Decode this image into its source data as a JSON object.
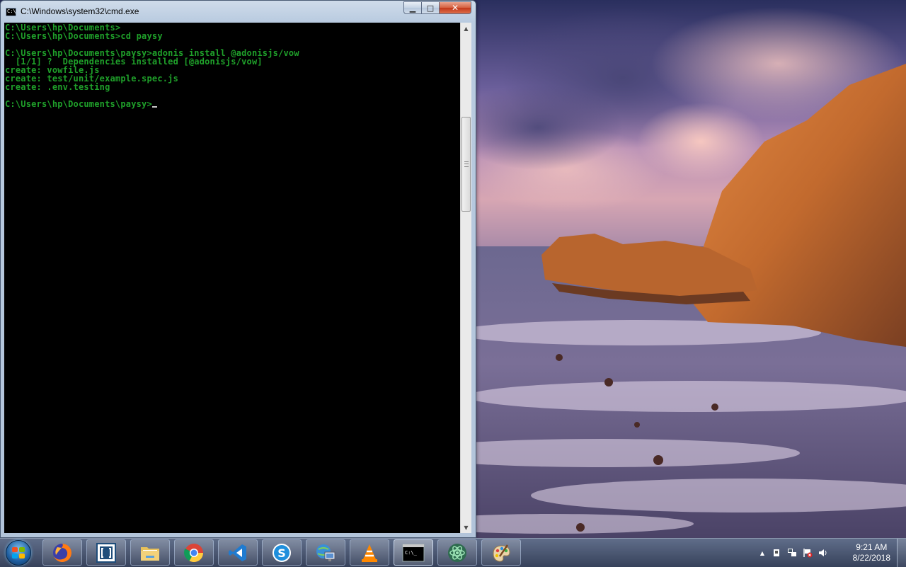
{
  "window": {
    "title": "C:\\Windows\\system32\\cmd.exe",
    "icon_label": "C:\\",
    "controls": {
      "minimize": "▁",
      "maximize": "□",
      "close": "✕"
    }
  },
  "console": {
    "lines": [
      "C:\\Users\\hp\\Documents>",
      "C:\\Users\\hp\\Documents>cd paysy",
      "",
      "C:\\Users\\hp\\Documents\\paysy>adonis install @adonisjs/vow",
      "  [1/1] ?  Dependencies installed [@adonisjs/vow]",
      "create: vowfile.js",
      "create: test/unit/example.spec.js",
      "create: .env.testing",
      "",
      "C:\\Users\\hp\\Documents\\paysy>"
    ],
    "text_color": "#1fa02a",
    "background": "#000000"
  },
  "scrollbar": {
    "up_arrow": "▲",
    "down_arrow": "▼",
    "position_fraction": 0.17
  },
  "taskbar": {
    "start": "start-orb",
    "pinned": [
      {
        "name": "firefox",
        "icon": "firefox-icon"
      },
      {
        "name": "brackets",
        "icon": "brackets-icon"
      },
      {
        "name": "explorer",
        "icon": "folder-icon"
      },
      {
        "name": "chrome",
        "icon": "chrome-icon"
      },
      {
        "name": "vscode",
        "icon": "vscode-icon"
      },
      {
        "name": "skype",
        "icon": "skype-icon"
      },
      {
        "name": "network",
        "icon": "network-computer-icon"
      },
      {
        "name": "vlc",
        "icon": "vlc-icon"
      },
      {
        "name": "cmd",
        "icon": "cmd-icon",
        "active": true,
        "label": "C:\\_"
      },
      {
        "name": "atom",
        "icon": "atom-icon"
      },
      {
        "name": "paint",
        "icon": "paint-icon"
      }
    ],
    "tray": {
      "expand": "▲",
      "time": "9:21 AM",
      "date": "8/22/2018"
    }
  }
}
